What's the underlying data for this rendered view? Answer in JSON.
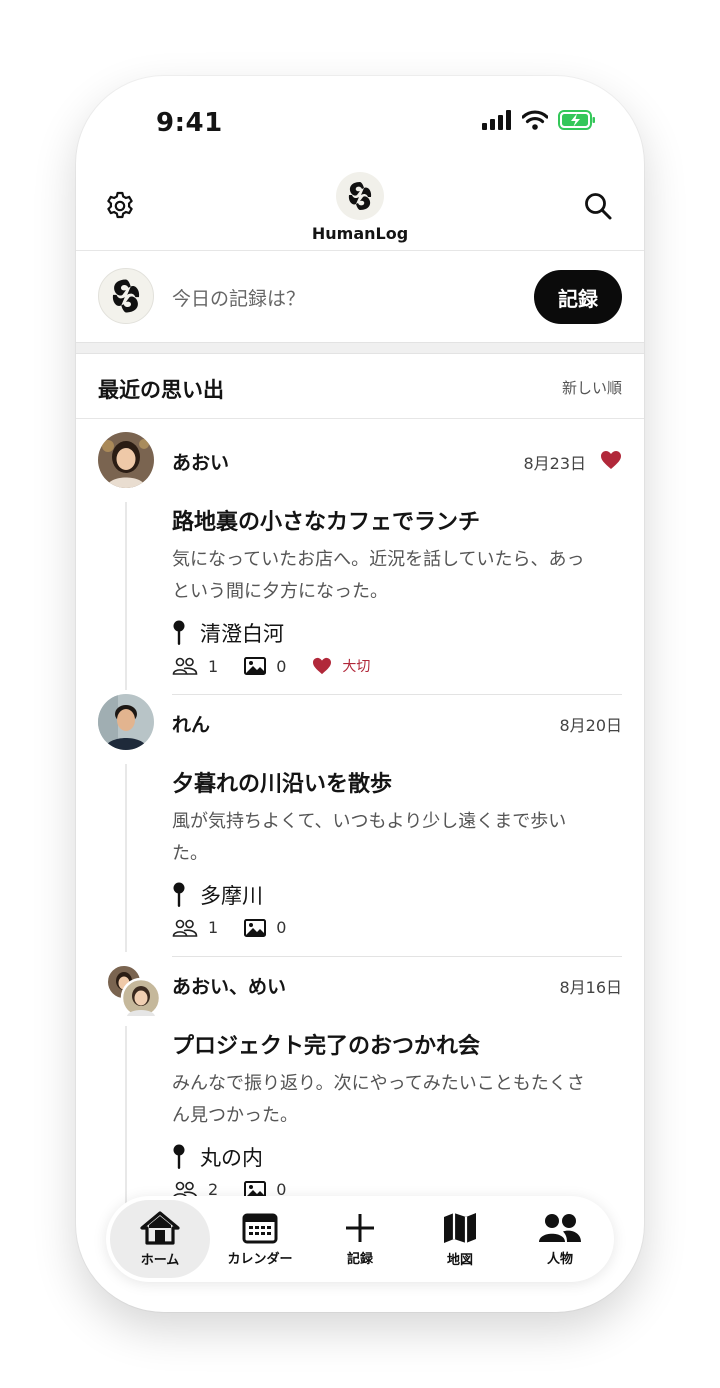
{
  "status": {
    "time": "9:41"
  },
  "app": {
    "name": "HumanLog"
  },
  "composer": {
    "placeholder": "今日の記録は？",
    "button": "記録"
  },
  "section": {
    "title": "最近の思い出",
    "sort": "新しい順"
  },
  "posts": [
    {
      "author": "あおい",
      "date": "8月23日",
      "favorite": true,
      "title": "路地裏の小さなカフェでランチ",
      "body": "気になっていたお店へ。近況を話していたら、あっという間に夕方になった。",
      "location": "清澄白河",
      "people": "1",
      "photos": "0",
      "favorite_label": "大切"
    },
    {
      "author": "れん",
      "date": "8月20日",
      "favorite": false,
      "title": "夕暮れの川沿いを散歩",
      "body": "風が気持ちよくて、いつもより少し遠くまで歩いた。",
      "location": "多摩川",
      "people": "1",
      "photos": "0"
    },
    {
      "author": "あおい、めい",
      "date": "8月16日",
      "favorite": false,
      "title": "プロジェクト完了のおつかれ会",
      "body": "みんなで振り返り。次にやってみたいこともたくさん見つかった。",
      "location": "丸の内",
      "people": "2",
      "photos": "0"
    }
  ],
  "tabs": [
    {
      "label": "ホーム",
      "icon": "home-icon",
      "active": true
    },
    {
      "label": "カレンダー",
      "icon": "calendar-icon",
      "active": false
    },
    {
      "label": "記録",
      "icon": "plus-icon",
      "active": false
    },
    {
      "label": "地図",
      "icon": "map-icon",
      "active": false
    },
    {
      "label": "人物",
      "icon": "people-icon",
      "active": false
    }
  ],
  "colors": {
    "accent": "#0b0b0b",
    "favorite": "#b1283a",
    "battery": "#34c759"
  }
}
